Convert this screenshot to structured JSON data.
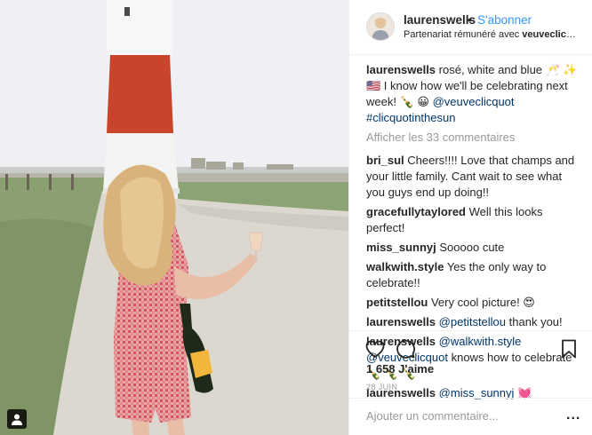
{
  "post_image": {
    "alt_icon": "person-tag-icon"
  },
  "header": {
    "username": "laurenswells",
    "separator": "•",
    "follow_label": "S'abonner",
    "partnership_prefix": "Partenariat rémunéré avec",
    "partnership_brand": "veuveclicquot"
  },
  "caption": {
    "username": "laurenswells",
    "text_1": "rosé, white and blue 🥂 ✨ 🇺🇸 I know how we'll be celebrating next week! 🍾 😀",
    "mention": "@veuveclicquot",
    "hashtag": "#clicquotinthesun"
  },
  "view_all_label": "Afficher les 33 commentaires",
  "comments": [
    {
      "username": "bri_sul",
      "text": "Cheers!!!! Love that champs and your little family. Cant wait to see what you guys end up doing!!"
    },
    {
      "username": "gracefullytaylored",
      "text": "Well this looks perfect!"
    },
    {
      "username": "miss_sunnyj",
      "text": "Sooooo cute"
    },
    {
      "username": "walkwith.style",
      "text": "Yes the only way to celebrate!!"
    },
    {
      "username": "petitstellou",
      "text": "Very cool picture! 😍"
    },
    {
      "username": "laurenswells",
      "mention": "@petitstellou",
      "text": "thank you!"
    },
    {
      "username": "laurenswells",
      "mention": "@walkwith.style @veuveclicquot",
      "text": "knows how to celebrate 🍾 🍾 🍾"
    },
    {
      "username": "laurenswells",
      "mention": "@miss_sunnyj",
      "text": "💓"
    }
  ],
  "actions": {
    "like_icon": "heart-icon",
    "comment_icon": "comment-bubble-icon",
    "save_icon": "bookmark-icon"
  },
  "likes_label": "1 658 J'aime",
  "date_label": "28 JUIN",
  "add_comment": {
    "placeholder": "Ajouter un commentaire...",
    "more_label": "..."
  },
  "colors": {
    "link_blue": "#3897f0",
    "mention_blue": "#003569",
    "muted_gray": "#999999",
    "text_dark": "#262626"
  }
}
